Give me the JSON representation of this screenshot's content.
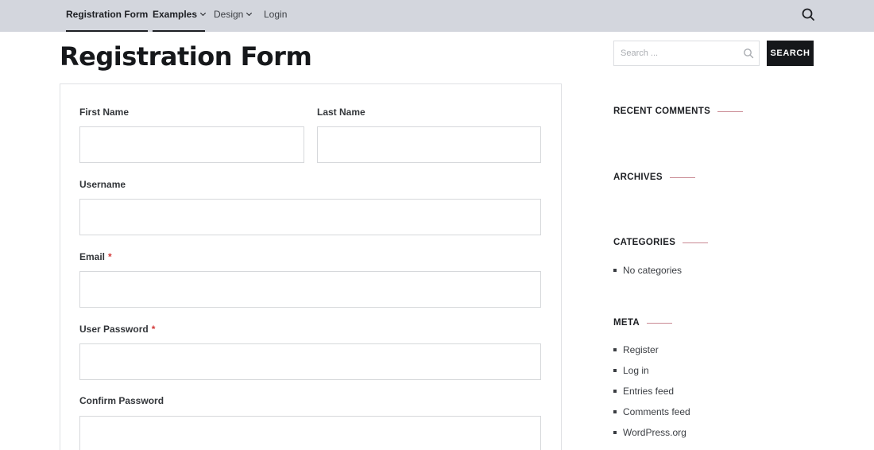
{
  "nav": {
    "items": [
      {
        "label": "Registration Form"
      },
      {
        "label": "Examples"
      },
      {
        "label": "Design"
      },
      {
        "label": "Login"
      }
    ]
  },
  "page": {
    "title": "Registration Form"
  },
  "form": {
    "first_name_label": "First Name",
    "last_name_label": "Last Name",
    "username_label": "Username",
    "email_label": "Email",
    "password_label": "User Password",
    "confirm_password_label": "Confirm Password",
    "required_marker": "*",
    "first_name_value": "",
    "last_name_value": "",
    "username_value": "",
    "email_value": "",
    "password_value": "",
    "confirm_password_value": ""
  },
  "sidebar": {
    "search": {
      "placeholder": "Search ...",
      "button_label": "SEARCH"
    },
    "recent_comments_title": "RECENT COMMENTS",
    "archives_title": "ARCHIVES",
    "categories_title": "CATEGORIES",
    "categories": [
      "No categories"
    ],
    "meta_title": "META",
    "meta_links": [
      "Register",
      "Log in",
      "Entries feed",
      "Comments feed",
      "WordPress.org"
    ]
  },
  "colors": {
    "nav_bg": "#d3d6dd",
    "accent_line": "#c98a93",
    "required": "#d33a3a",
    "button_bg": "#15171a"
  },
  "icons": {
    "nav_search": "search-icon",
    "dropdown": "chevron-down-icon",
    "field_search": "search-icon"
  }
}
